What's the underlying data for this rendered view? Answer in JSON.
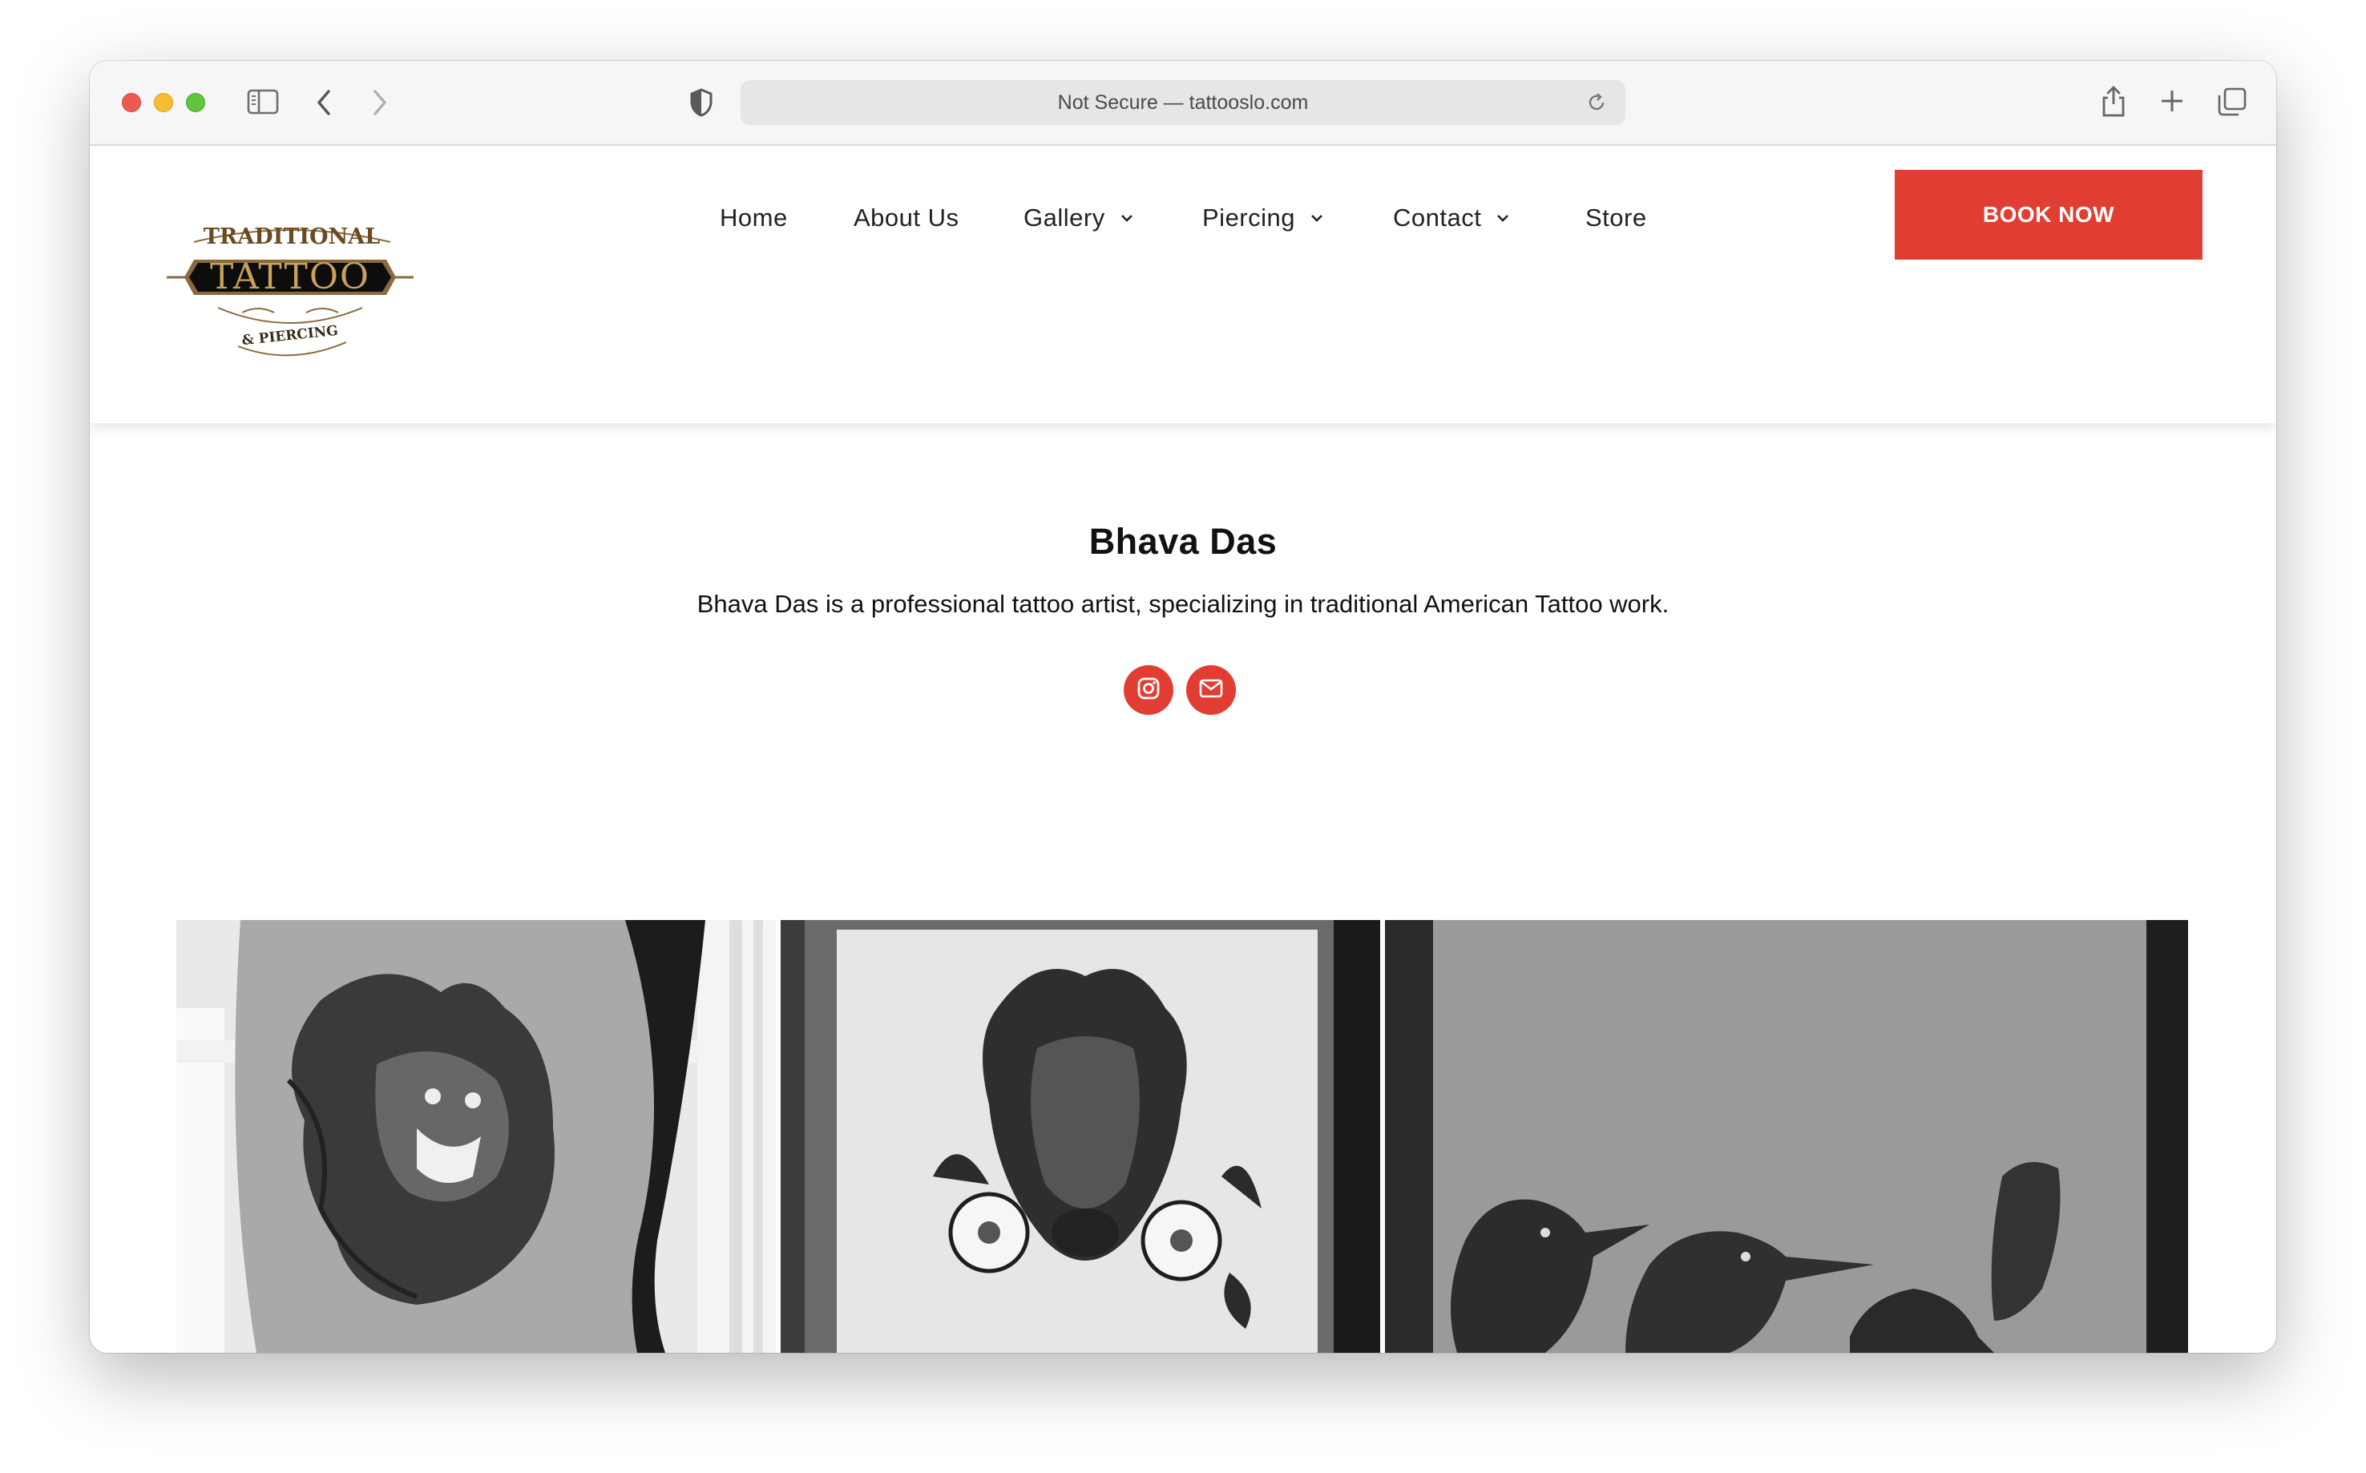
{
  "browser": {
    "url_text": "Not Secure — tattooslo.com"
  },
  "logo": {
    "top_text": "TRADITIONAL",
    "main_text": "TATTOO",
    "bottom_text": "& PIERCING"
  },
  "nav": {
    "items": [
      {
        "label": "Home",
        "has_dropdown": false
      },
      {
        "label": "About Us",
        "has_dropdown": false
      },
      {
        "label": "Gallery",
        "has_dropdown": true
      },
      {
        "label": "Piercing",
        "has_dropdown": true
      },
      {
        "label": "Contact",
        "has_dropdown": true
      },
      {
        "label": "Store",
        "has_dropdown": false
      }
    ],
    "book_label": "BOOK NOW"
  },
  "artist": {
    "name": "Bhava Das",
    "bio": "Bhava Das is a professional tattoo artist, specializing in traditional American Tattoo work."
  },
  "social": {
    "icons": [
      "instagram-icon",
      "mail-icon"
    ]
  },
  "gallery": {
    "images": [
      "panther-rose-tattoo",
      "bison-flowers-drawing",
      "crows-tattoo"
    ]
  },
  "colors": {
    "accent": "#e23d32",
    "text": "#111111"
  }
}
